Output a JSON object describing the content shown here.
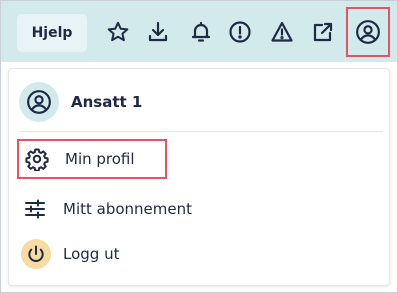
{
  "topbar": {
    "help_label": "Hjelp",
    "icons": [
      "star-icon",
      "download-icon",
      "bell-icon",
      "info-circle-icon",
      "warning-triangle-icon",
      "external-link-icon",
      "account-circle-icon"
    ],
    "background": "#d3eaec",
    "highlight_color": "#e25563"
  },
  "menu": {
    "user_name": "Ansatt 1",
    "items": [
      {
        "label": "Min profil",
        "icon": "gear-icon"
      },
      {
        "label": "Mitt abonnement",
        "icon": "sliders-icon"
      },
      {
        "label": "Logg ut",
        "icon": "power-icon"
      }
    ]
  }
}
